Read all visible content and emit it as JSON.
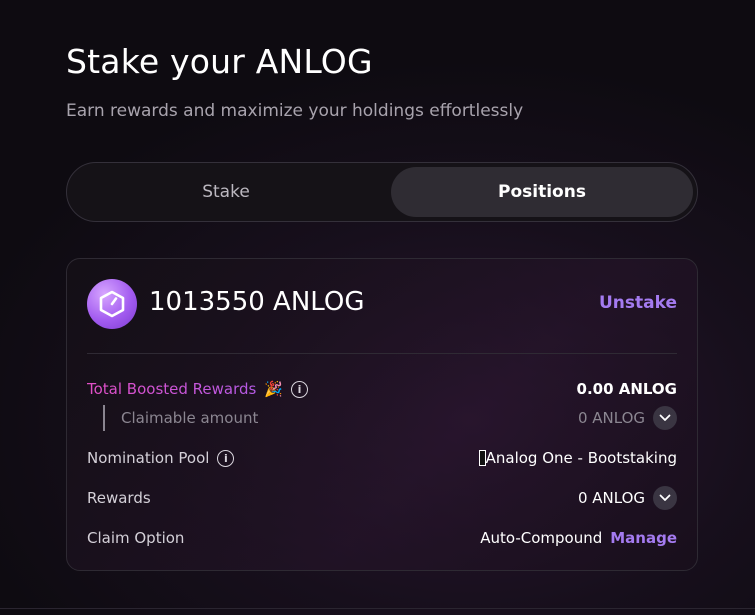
{
  "header": {
    "title": "Stake your ANLOG",
    "subtitle": "Earn rewards and maximize your holdings effortlessly"
  },
  "tabs": [
    {
      "label": "Stake",
      "active": false
    },
    {
      "label": "Positions",
      "active": true
    }
  ],
  "position": {
    "amount": "1013550 ANLOG",
    "unstake_label": "Unstake",
    "boosted_rewards": {
      "label": "Total Boosted Rewards",
      "emoji": "🎉",
      "value": "0.00 ANLOG"
    },
    "claimable": {
      "label": "Claimable amount",
      "value": "0 ANLOG"
    },
    "nomination_pool": {
      "label": "Nomination Pool",
      "value": "Analog One - Bootstaking"
    },
    "rewards": {
      "label": "Rewards",
      "value": "0 ANLOG"
    },
    "claim_option": {
      "label": "Claim Option",
      "value": "Auto-Compound",
      "manage_label": "Manage"
    }
  },
  "colors": {
    "accent": "#a47bf0",
    "boosted_gradient_start": "#e24fc6",
    "boosted_gradient_end": "#b65be6",
    "background": "#170f1c"
  },
  "icons": {
    "logo": "analog-logo-icon",
    "info": "info-icon",
    "chevron": "chevron-down-icon"
  }
}
